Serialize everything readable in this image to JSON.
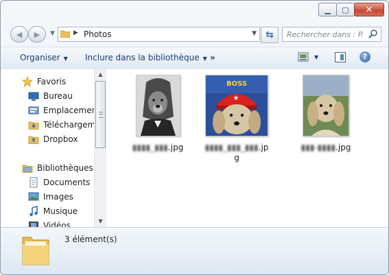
{
  "window": {
    "caption_buttons": [
      {
        "name": "minimize-button",
        "glyph": "▁"
      },
      {
        "name": "maximize-button",
        "glyph": "▢"
      },
      {
        "name": "close-button",
        "glyph": "✕"
      }
    ]
  },
  "navigation": {
    "address_path": "Photos",
    "search_placeholder": "Rechercher dans : P..."
  },
  "toolbar": {
    "organize_label": "Organiser",
    "include_label": "Inclure dans la bibliothèque",
    "more_label": "»",
    "help_label": "?"
  },
  "sidebar": {
    "favorites_header": "Favoris",
    "favorites": [
      {
        "label": "Bureau",
        "icon": "desktop-icon"
      },
      {
        "label": "Emplacement",
        "icon": "recent-places-icon"
      },
      {
        "label": "Téléchargeme",
        "icon": "downloads-icon"
      },
      {
        "label": "Dropbox",
        "icon": "dropbox-icon"
      }
    ],
    "libraries_header": "Bibliothèques",
    "libraries": [
      {
        "label": "Documents",
        "icon": "documents-icon"
      },
      {
        "label": "Images",
        "icon": "images-icon"
      },
      {
        "label": "Musique",
        "icon": "music-icon"
      },
      {
        "label": "Vidéos",
        "icon": "videos-icon"
      }
    ]
  },
  "files": [
    {
      "name_hidden": "▮▮▮▮_▮▮▮",
      "ext": ".jpg",
      "thumb": "dog-with-long-hair-bw"
    },
    {
      "name_hidden": "▮▮▮▮_▮▮▮_▮▮▮",
      "ext": ".jpg",
      "thumb": "dog-red-cap-color",
      "badge_text": "BOSS"
    },
    {
      "name_hidden": "▮▮▮-▮▮▮▮",
      "ext": ".jpg",
      "thumb": "dog-portrait-color"
    }
  ],
  "status": {
    "item_count": "3 élément(s)"
  }
}
